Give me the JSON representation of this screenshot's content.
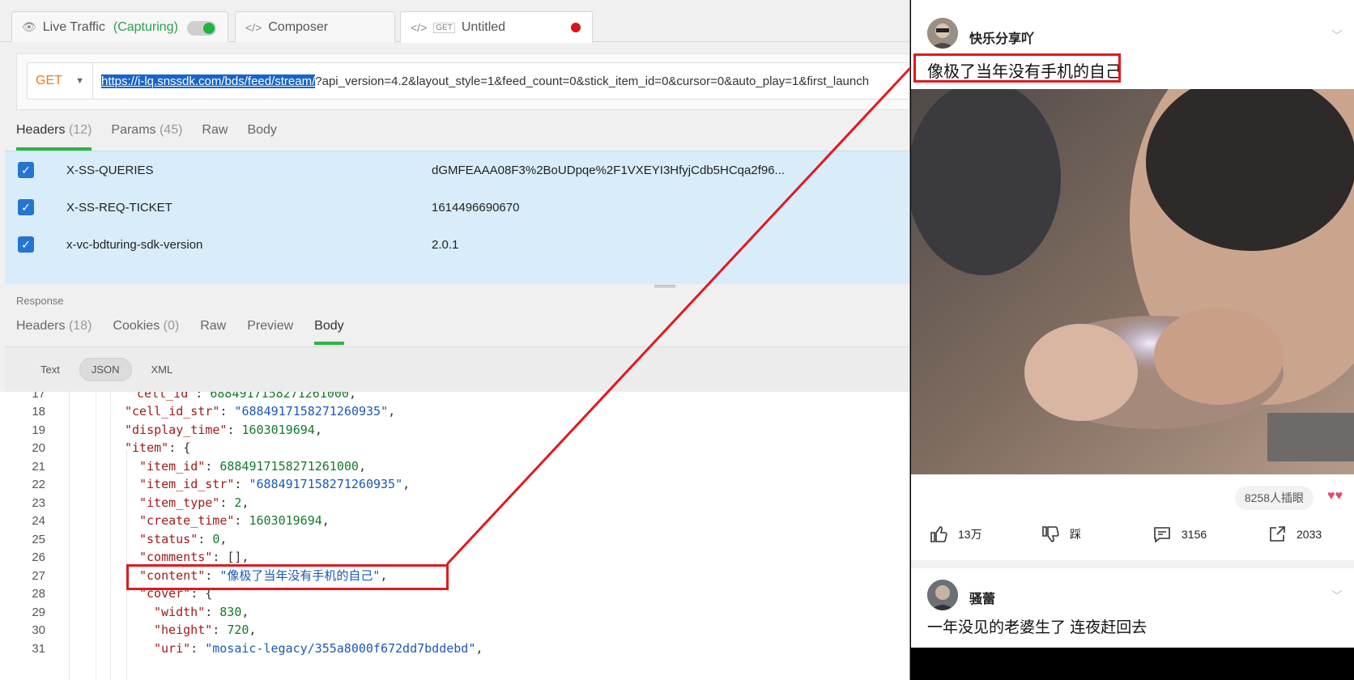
{
  "tabs": {
    "live_traffic": "Live Traffic",
    "capturing": "(Capturing)",
    "composer": "Composer",
    "untitled": "Untitled",
    "get_badge": "GET"
  },
  "request": {
    "method": "GET",
    "url_highlight": "https://i-lq.snssdk.com/bds/feed/stream/",
    "url_rest": "?api_version=4.2&layout_style=1&feed_count=0&stick_item_id=0&cursor=0&auto_play=1&first_launch"
  },
  "request_tabs": [
    {
      "label": "Headers",
      "count": "(12)"
    },
    {
      "label": "Params",
      "count": "(45)"
    },
    {
      "label": "Raw",
      "count": ""
    },
    {
      "label": "Body",
      "count": ""
    }
  ],
  "headers": [
    {
      "key": "X-SS-QUERIES",
      "value": "dGMFEAAA08F3%2BoUDpqe%2F1VXEYI3HfyjCdb5HCqa2f96..."
    },
    {
      "key": "X-SS-REQ-TICKET",
      "value": "1614496690670"
    },
    {
      "key": "x-vc-bdturing-sdk-version",
      "value": "2.0.1"
    }
  ],
  "response": {
    "label": "Response",
    "tabs": [
      {
        "label": "Headers",
        "count": "(18)"
      },
      {
        "label": "Cookies",
        "count": "(0)"
      },
      {
        "label": "Raw",
        "count": ""
      },
      {
        "label": "Preview",
        "count": ""
      },
      {
        "label": "Body",
        "count": ""
      }
    ],
    "formats": [
      "Text",
      "JSON",
      "XML"
    ]
  },
  "code_lines": [
    {
      "n": "17",
      "indent": 160,
      "parts": [
        [
          "k",
          "\"cell_id\""
        ],
        [
          "p",
          ": "
        ],
        [
          "n",
          "6884917158271261000"
        ],
        [
          "p",
          ","
        ]
      ]
    },
    {
      "n": "18",
      "indent": 154,
      "parts": [
        [
          "k",
          "\"cell_id_str\""
        ],
        [
          "p",
          ": "
        ],
        [
          "s",
          "\"6884917158271260935\""
        ],
        [
          "p",
          ","
        ]
      ]
    },
    {
      "n": "19",
      "indent": 154,
      "parts": [
        [
          "k",
          "\"display_time\""
        ],
        [
          "p",
          ": "
        ],
        [
          "n",
          "1603019694"
        ],
        [
          "p",
          ","
        ]
      ]
    },
    {
      "n": "20",
      "indent": 154,
      "parts": [
        [
          "k",
          "\"item\""
        ],
        [
          "p",
          ": {"
        ]
      ]
    },
    {
      "n": "21",
      "indent": 172,
      "parts": [
        [
          "k",
          "\"item_id\""
        ],
        [
          "p",
          ": "
        ],
        [
          "n",
          "6884917158271261000"
        ],
        [
          "p",
          ","
        ]
      ]
    },
    {
      "n": "22",
      "indent": 172,
      "parts": [
        [
          "k",
          "\"item_id_str\""
        ],
        [
          "p",
          ": "
        ],
        [
          "s",
          "\"6884917158271260935\""
        ],
        [
          "p",
          ","
        ]
      ]
    },
    {
      "n": "23",
      "indent": 172,
      "parts": [
        [
          "k",
          "\"item_type\""
        ],
        [
          "p",
          ": "
        ],
        [
          "n",
          "2"
        ],
        [
          "p",
          ","
        ]
      ]
    },
    {
      "n": "24",
      "indent": 172,
      "parts": [
        [
          "k",
          "\"create_time\""
        ],
        [
          "p",
          ": "
        ],
        [
          "n",
          "1603019694"
        ],
        [
          "p",
          ","
        ]
      ]
    },
    {
      "n": "25",
      "indent": 172,
      "parts": [
        [
          "k",
          "\"status\""
        ],
        [
          "p",
          ": "
        ],
        [
          "n",
          "0"
        ],
        [
          "p",
          ","
        ]
      ]
    },
    {
      "n": "26",
      "indent": 172,
      "parts": [
        [
          "k",
          "\"comments\""
        ],
        [
          "p",
          ": [],"
        ]
      ]
    },
    {
      "n": "27",
      "indent": 172,
      "parts": [
        [
          "k",
          "\"content\""
        ],
        [
          "p",
          ": "
        ],
        [
          "s",
          "\"像极了当年没有手机的自己\""
        ],
        [
          "p",
          ","
        ]
      ]
    },
    {
      "n": "28",
      "indent": 172,
      "parts": [
        [
          "k",
          "\"cover\""
        ],
        [
          "p",
          ": {"
        ]
      ]
    },
    {
      "n": "29",
      "indent": 190,
      "parts": [
        [
          "k",
          "\"width\""
        ],
        [
          "p",
          ": "
        ],
        [
          "n",
          "830"
        ],
        [
          "p",
          ","
        ]
      ]
    },
    {
      "n": "30",
      "indent": 190,
      "parts": [
        [
          "k",
          "\"height\""
        ],
        [
          "p",
          ": "
        ],
        [
          "n",
          "720"
        ],
        [
          "p",
          ","
        ]
      ]
    },
    {
      "n": "31",
      "indent": 190,
      "parts": [
        [
          "k",
          "\"uri\""
        ],
        [
          "p",
          ": "
        ],
        [
          "s",
          "\"mosaic-legacy/355a8000f672dd7bddebd\""
        ],
        [
          "p",
          ","
        ]
      ]
    }
  ],
  "feed": {
    "post1": {
      "username": "快乐分享吖",
      "title": "像极了当年没有手机的自己",
      "views": "8258人插眼",
      "likes": "13万",
      "dislike": "踩",
      "comments": "3156",
      "shares": "2033"
    },
    "post2": {
      "username": "骚蕾",
      "title": "一年没见的老婆生了 连夜赶回去"
    }
  },
  "colors": {
    "accent_green": "#2cb442",
    "annotation_red": "#e1191e",
    "method_orange": "#f07c1a",
    "selected_header_bg": "#d8edf9"
  }
}
